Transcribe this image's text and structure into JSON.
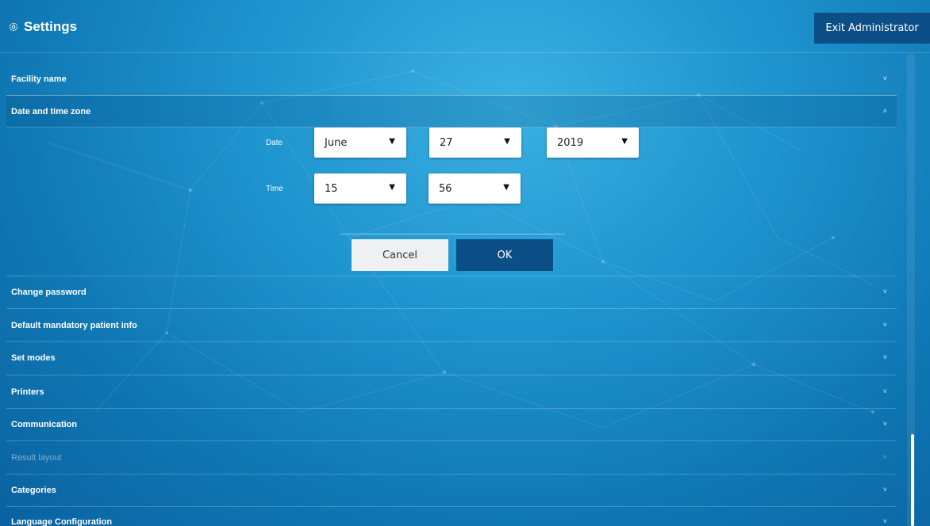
{
  "header": {
    "title": "Settings",
    "exit_button": "Exit Administrator"
  },
  "sections": {
    "facility_name": "Facility name",
    "date_time": "Date and time zone",
    "change_password": "Change password",
    "mandatory_info": "Default mandatory patient info",
    "set_modes": "Set modes",
    "printers": "Printers",
    "communication": "Communication",
    "result_layout": "Result layout",
    "categories": "Categories",
    "language": "Language Configuration"
  },
  "date_time_panel": {
    "date_label": "Date",
    "time_label": "Time",
    "month": "June",
    "day": "27",
    "year": "2019",
    "hour": "15",
    "minute": "56",
    "cancel_label": "Cancel",
    "ok_label": "OK"
  },
  "icons": {
    "chevron_down": "˅",
    "chevron_up": "˄",
    "dropdown_caret": "▼"
  },
  "colors": {
    "accent_dark": "#0c4f86",
    "background": "#1f95cf"
  }
}
